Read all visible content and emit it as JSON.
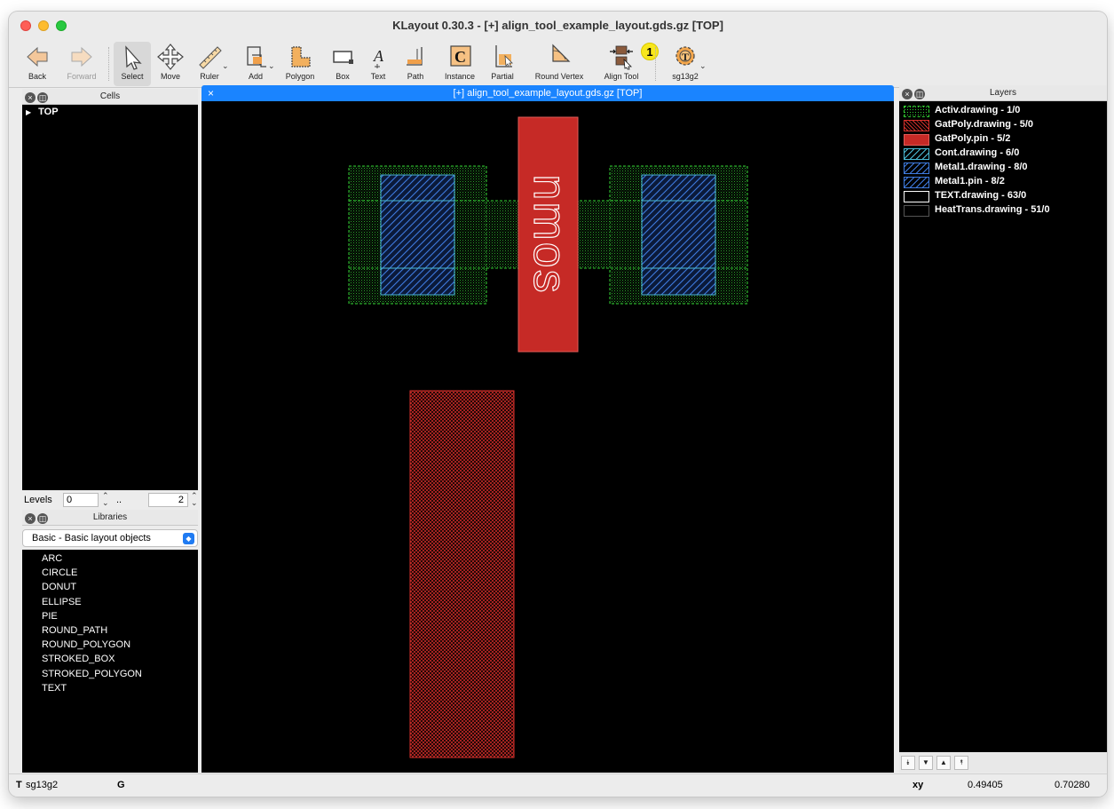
{
  "window": {
    "title": "KLayout 0.30.3 - [+] align_tool_example_layout.gds.gz [TOP]"
  },
  "toolbar": {
    "back": "Back",
    "forward": "Forward",
    "select": "Select",
    "move": "Move",
    "ruler": "Ruler",
    "add": "Add",
    "polygon": "Polygon",
    "box": "Box",
    "text": "Text",
    "path": "Path",
    "instance": "Instance",
    "partial": "Partial",
    "round_vertex": "Round Vertex",
    "align_tool": "Align Tool",
    "tech": "sg13g2",
    "callout": "1"
  },
  "cells": {
    "title": "Cells",
    "items": [
      {
        "label": "TOP"
      }
    ]
  },
  "levels": {
    "label": "Levels",
    "from": "0",
    "sep": "..",
    "to": "2"
  },
  "libraries": {
    "title": "Libraries",
    "selected": "Basic - Basic layout objects",
    "items": [
      "ARC",
      "CIRCLE",
      "DONUT",
      "ELLIPSE",
      "PIE",
      "ROUND_PATH",
      "ROUND_POLYGON",
      "STROKED_BOX",
      "STROKED_POLYGON",
      "TEXT"
    ]
  },
  "tab": {
    "label": "[+] align_tool_example_layout.gds.gz [TOP]",
    "close": "×"
  },
  "layout": {
    "text": "nmos"
  },
  "layers": {
    "title": "Layers",
    "items": [
      {
        "label": "Activ.drawing - 1/0",
        "color": "#32cd32"
      },
      {
        "label": "GatPoly.drawing - 5/0",
        "color": "#d8312c"
      },
      {
        "label": "GatPoly.pin - 5/2",
        "color": "#c62a26"
      },
      {
        "label": "Cont.drawing - 6/0",
        "color": "#4bbcd6"
      },
      {
        "label": "Metal1.drawing - 8/0",
        "color": "#3f7be0"
      },
      {
        "label": "Metal1.pin - 8/2",
        "color": "#3f7be0"
      },
      {
        "label": "TEXT.drawing - 63/0",
        "color": "#ffffff"
      },
      {
        "label": "HeatTrans.drawing - 51/0",
        "color": "#000000"
      }
    ]
  },
  "status": {
    "tech_prefix": "T",
    "tech": "sg13g2",
    "grid": "G",
    "coord_label": "xy",
    "x": "0.49405",
    "y": "0.70280"
  }
}
